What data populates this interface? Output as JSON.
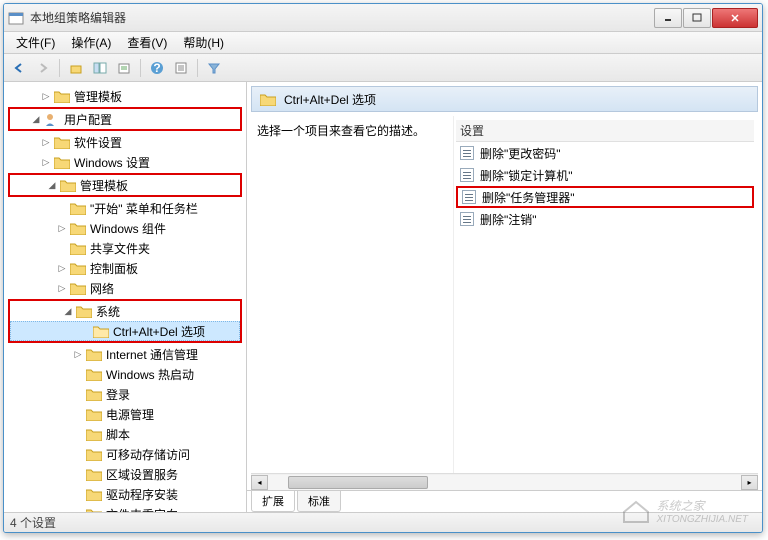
{
  "window": {
    "title": "本地组策略编辑器"
  },
  "menu": {
    "file": "文件(F)",
    "action": "操作(A)",
    "view": "查看(V)",
    "help": "帮助(H)"
  },
  "toolbar_icons": [
    "back",
    "forward",
    "up",
    "show-hide",
    "export",
    "refresh",
    "help",
    "properties",
    "filter"
  ],
  "tree": {
    "admin_templates": "管理模板",
    "user_config": "用户配置",
    "software_settings": "软件设置",
    "windows_settings": "Windows 设置",
    "admin_templates2": "管理模板",
    "start_taskbar": "\"开始\" 菜单和任务栏",
    "windows_components": "Windows 组件",
    "shared_folders": "共享文件夹",
    "control_panel": "控制面板",
    "network": "网络",
    "system": "系统",
    "ctrl_alt_del": "Ctrl+Alt+Del 选项",
    "internet_mgmt": "Internet 通信管理",
    "windows_hotstart": "Windows 热启动",
    "logon": "登录",
    "power_mgmt": "电源管理",
    "scripts": "脚本",
    "removable_storage": "可移动存储访问",
    "locale_services": "区域设置服务",
    "driver_install": "驱动程序安装",
    "folder_redirect": "文件夹重定向"
  },
  "right": {
    "header": "Ctrl+Alt+Del 选项",
    "desc": "选择一个项目来查看它的描述。",
    "settings_label": "设置",
    "items": {
      "change_password": "删除\"更改密码\"",
      "lock_computer": "删除\"锁定计算机\"",
      "task_manager": "删除\"任务管理器\"",
      "logoff": "删除\"注销\""
    }
  },
  "tabs": {
    "extended": "扩展",
    "standard": "标准"
  },
  "status": "4 个设置",
  "watermark": {
    "name": "系统之家",
    "url": "XITONGZHIJIA.NET"
  }
}
